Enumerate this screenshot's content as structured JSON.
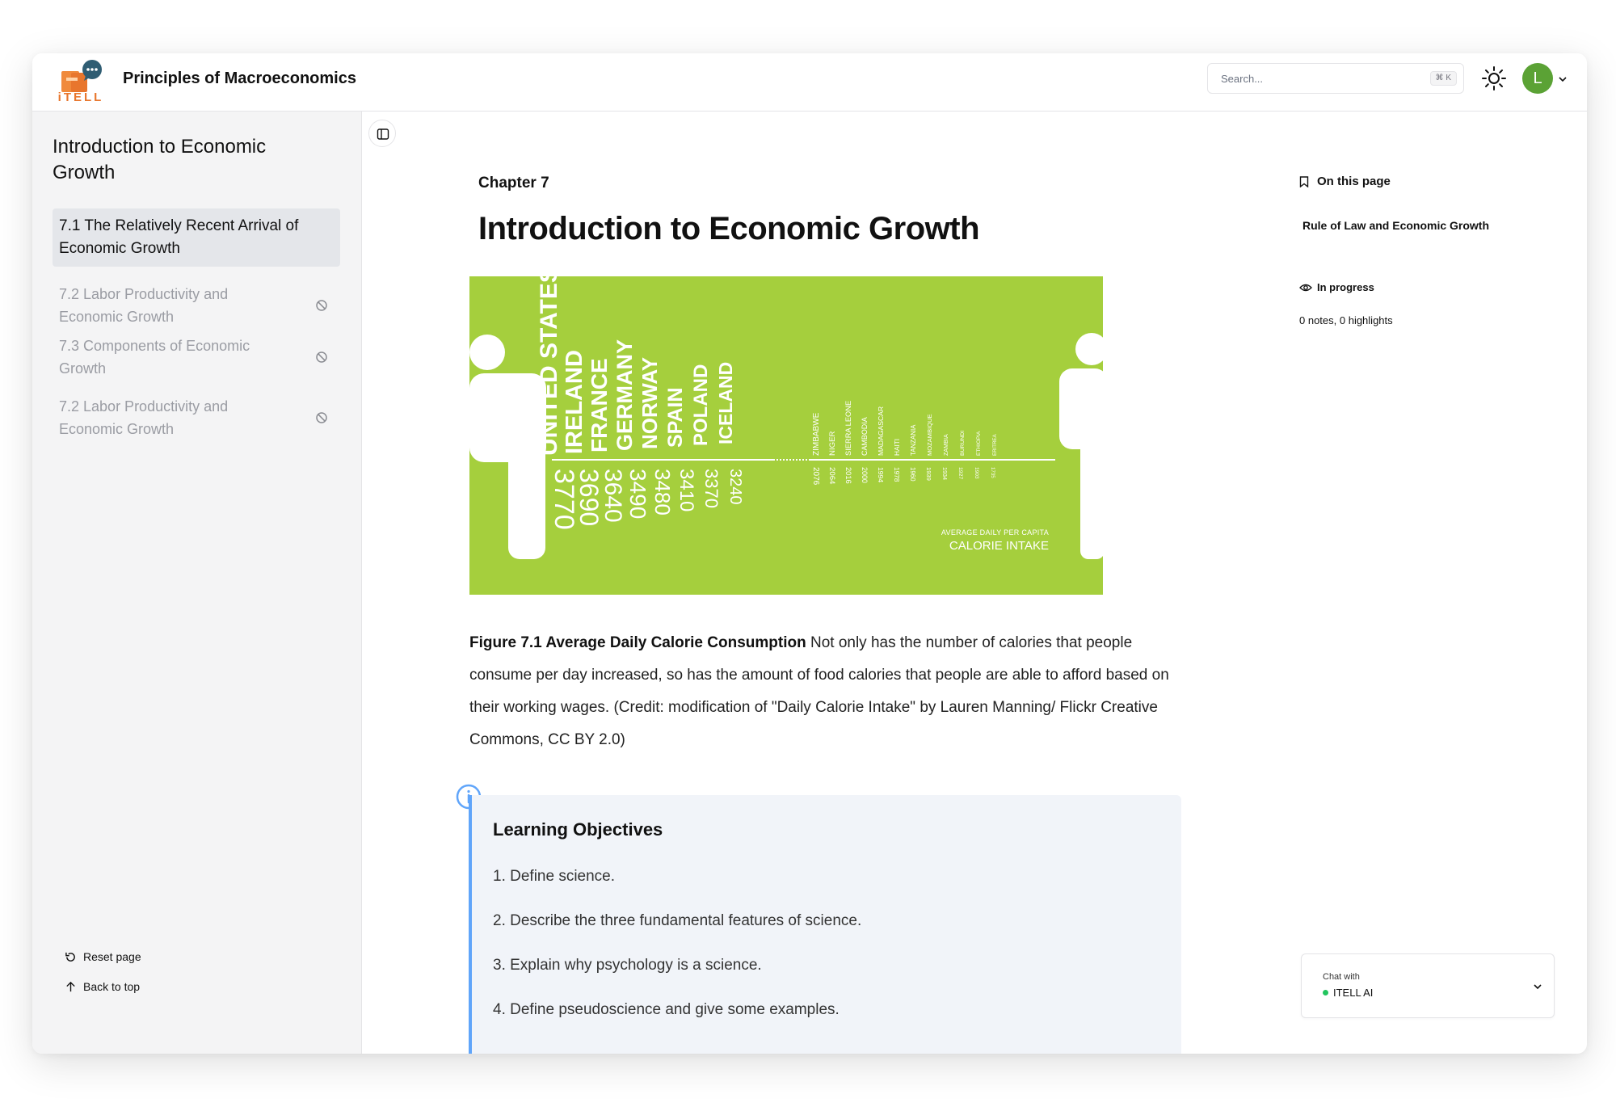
{
  "app": {
    "logo_text": "iTELL",
    "title": "Principles of Macroeconomics"
  },
  "search": {
    "placeholder": "Search...",
    "shortcut": "⌘ K"
  },
  "user": {
    "initial": "L",
    "avatar_color": "#5ba235"
  },
  "sidebar": {
    "title": "Introduction to Economic Growth",
    "items": [
      {
        "label": "7.1 The Relatively Recent Arrival of Economic Growth",
        "state": "active"
      },
      {
        "label": "7.2 Labor Productivity and Economic Growth",
        "state": "locked"
      },
      {
        "label": "7.3 Components of Economic Growth",
        "state": "locked"
      },
      {
        "label": "7.2 Labor Productivity and Economic Growth",
        "state": "locked"
      }
    ],
    "reset_label": "Reset page",
    "back_label": "Back to top"
  },
  "main": {
    "chapter": "Chapter 7",
    "title": "Introduction to Economic Growth",
    "caption_bold": "Figure 7.1 Average Daily Calorie Consumption",
    "caption_text": " Not only has the number of calories that people consume per day increased, so has the amount of food calories that people are able to afford based on their working wages. (Credit: modification of \"Daily Calorie Intake\" by Lauren Manning/ Flickr Creative Commons, CC BY 2.0)",
    "objectives": {
      "title": "Learning Objectives",
      "items": [
        "1. Define science.",
        "2. Describe the three fundamental features of science.",
        "3. Explain why psychology is a science.",
        "4. Define pseudoscience and give some examples."
      ]
    }
  },
  "figure": {
    "background": "#a5cf3d",
    "subtitle": "AVERAGE DAILY PER CAPITA",
    "title": "CALORIE INTAKE",
    "countries": [
      {
        "name": "UNITED STATES",
        "value": "3770"
      },
      {
        "name": "IRELAND",
        "value": "3690"
      },
      {
        "name": "FRANCE",
        "value": "3640"
      },
      {
        "name": "GERMANY",
        "value": "3490"
      },
      {
        "name": "NORWAY",
        "value": "3480"
      },
      {
        "name": "SPAIN",
        "value": "3410"
      },
      {
        "name": "POLAND",
        "value": "3370"
      },
      {
        "name": "ICELAND",
        "value": "3240"
      }
    ],
    "small_countries": [
      {
        "name": "ZIMBABWE",
        "value": "2076"
      },
      {
        "name": "NIGER",
        "value": "2064"
      },
      {
        "name": "SIERRA LEONE",
        "value": "2016"
      },
      {
        "name": "CAMBODIA",
        "value": "2000"
      },
      {
        "name": "MADAGASCAR",
        "value": "1994"
      },
      {
        "name": "HAITI",
        "value": "1978"
      },
      {
        "name": "TANZANIA",
        "value": "1960"
      },
      {
        "name": "MOZAMBIQUE",
        "value": "1939"
      },
      {
        "name": "ZAMBIA",
        "value": "1934"
      },
      {
        "name": "BURUNDI",
        "value": "1927"
      },
      {
        "name": "ETHIOPIA",
        "value": "1903"
      },
      {
        "name": "ERITREA",
        "value": "1735"
      },
      {
        "name": "",
        "value": ""
      },
      {
        "name": "",
        "value": ""
      },
      {
        "name": "",
        "value": ""
      }
    ]
  },
  "toc": {
    "heading": "On this page",
    "links": [
      "Rule of Law and Economic Growth"
    ],
    "status": "In progress",
    "notes": "0 notes, 0 highlights"
  },
  "chat": {
    "label": "Chat with",
    "bot": "ITELL AI"
  }
}
